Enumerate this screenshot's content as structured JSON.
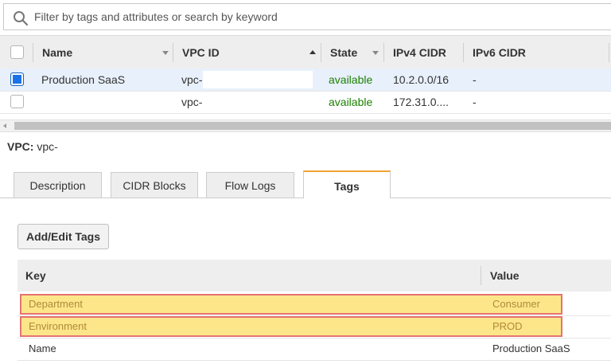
{
  "search": {
    "placeholder": "Filter by tags and attributes or search by keyword"
  },
  "table": {
    "columns": [
      "Name",
      "VPC ID",
      "State",
      "IPv4 CIDR",
      "IPv6 CIDR"
    ],
    "rows": [
      {
        "selected": true,
        "name": "Production SaaS",
        "vpc_id": "vpc-",
        "state": "available",
        "ipv4": "10.2.0.0/16",
        "ipv6": "-"
      },
      {
        "selected": false,
        "name": "",
        "vpc_id": "vpc-",
        "state": "available",
        "ipv4": "172.31.0....",
        "ipv6": "-"
      }
    ]
  },
  "detail": {
    "vpc_label": "VPC:",
    "vpc_value": "vpc-",
    "tabs": [
      "Description",
      "CIDR Blocks",
      "Flow Logs",
      "Tags"
    ],
    "active_tab": "Tags",
    "add_edit_button": "Add/Edit Tags",
    "tags_table": {
      "key_header": "Key",
      "value_header": "Value",
      "rows": [
        {
          "key": "Department",
          "value": "Consumer",
          "highlighted": true
        },
        {
          "key": "Environment",
          "value": "PROD",
          "highlighted": true
        },
        {
          "key": "Name",
          "value": "Production SaaS",
          "highlighted": false
        }
      ]
    }
  },
  "colors": {
    "available": "#1d8102",
    "active_tab_accent": "#f0a430",
    "highlight_fill": "#fde68a",
    "highlight_border": "#e57373",
    "checkbox_selected": "#1a73e8"
  },
  "icons": {
    "search": "search-icon"
  }
}
